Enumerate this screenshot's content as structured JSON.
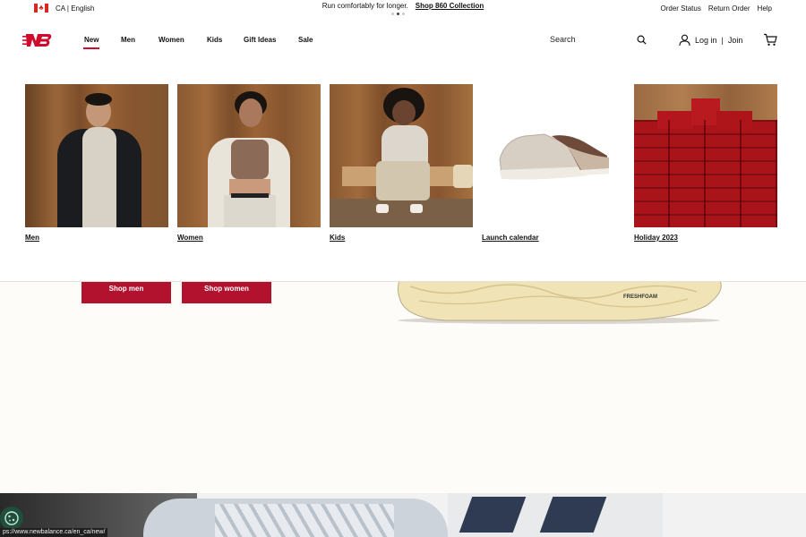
{
  "topbar": {
    "locale": "CA | English",
    "promo_text": "Run comfortably for longer.",
    "promo_link": "Shop 860 Collection",
    "util_links": [
      "Order Status",
      "Return Order",
      "Help"
    ]
  },
  "nav": {
    "items": [
      "New",
      "Men",
      "Women",
      "Kids",
      "Gift Ideas",
      "Sale"
    ],
    "search_placeholder": "Search",
    "login": "Log in",
    "join": "Join"
  },
  "mega_menu": {
    "tiles": [
      "Men",
      "Women",
      "Kids",
      "Launch calendar",
      "Holiday 2023"
    ]
  },
  "hero": {
    "buttons": [
      "Shop men",
      "Shop women"
    ],
    "shoe_text": "FRESHFOAM"
  },
  "status_bar": {
    "url": "ps://www.newbalance.ca/en_ca/new/"
  },
  "colors": {
    "accent": "#cf0a2c",
    "button": "#b3122e",
    "background": "#fdfcf9"
  }
}
